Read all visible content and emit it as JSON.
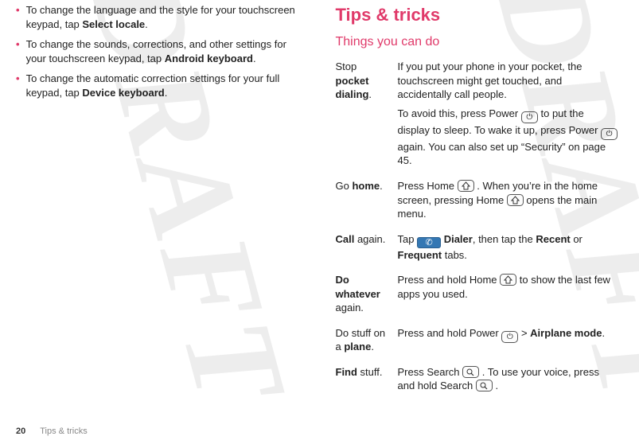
{
  "watermark": "DRAFT",
  "left_column": {
    "bullets": [
      {
        "pre": "To change the language and the style for your touchscreen keypad, tap ",
        "bold": "Select locale",
        "post": "."
      },
      {
        "pre": "To change the sounds, corrections, and other settings for your touchscreen keypad, tap ",
        "bold": "Android keyboard",
        "post": "."
      },
      {
        "pre": "To change the automatic correction settings for your full keypad, tap ",
        "bold": "Device keyboard",
        "post": "."
      }
    ]
  },
  "right_column": {
    "title": "Tips & tricks",
    "subtitle": "Things you can do",
    "rows": {
      "r1": {
        "l_pre": "Stop ",
        "l_b": "pocket dialing",
        "l_post": ".",
        "d_p1": "If you put your phone in your pocket, the touchscreen might get touched, and accidentally call people.",
        "d_p2a": "To avoid this, press Power",
        "d_p2b": "to put the display to sleep. To wake it up, press Power",
        "d_p2c": "again. You can also set up “Security” on page 45."
      },
      "r2": {
        "l_pre": "Go ",
        "l_b": "home",
        "l_post": ".",
        "d_a": "Press Home",
        "d_b": ". When you’re in the home screen, pressing Home",
        "d_c": "opens the main menu."
      },
      "r3": {
        "l_b": "Call",
        "l_post": " again.",
        "d_a": "Tap ",
        "d_b": "Dialer",
        "d_c": ", then tap the ",
        "d_d": "Recent",
        "d_e": " or ",
        "d_f": "Frequent",
        "d_g": " tabs."
      },
      "r4": {
        "l_b1": "Do whatever",
        "l_post": " again.",
        "d_a": "Press and hold Home",
        "d_b": "to show the last few apps you used."
      },
      "r5": {
        "l_pre": "Do stuff on a ",
        "l_b": "plane",
        "l_post": ".",
        "d_a": "Press and hold Power",
        "d_b": "> ",
        "d_c": "Airplane mode",
        "d_d": "."
      },
      "r6": {
        "l_b": "Find",
        "l_post": " stuff.",
        "d_a": "Press Search",
        "d_b": ". To use your voice, press and hold Search",
        "d_c": "."
      }
    }
  },
  "footer": {
    "page": "20",
    "text": "Tips & tricks"
  }
}
